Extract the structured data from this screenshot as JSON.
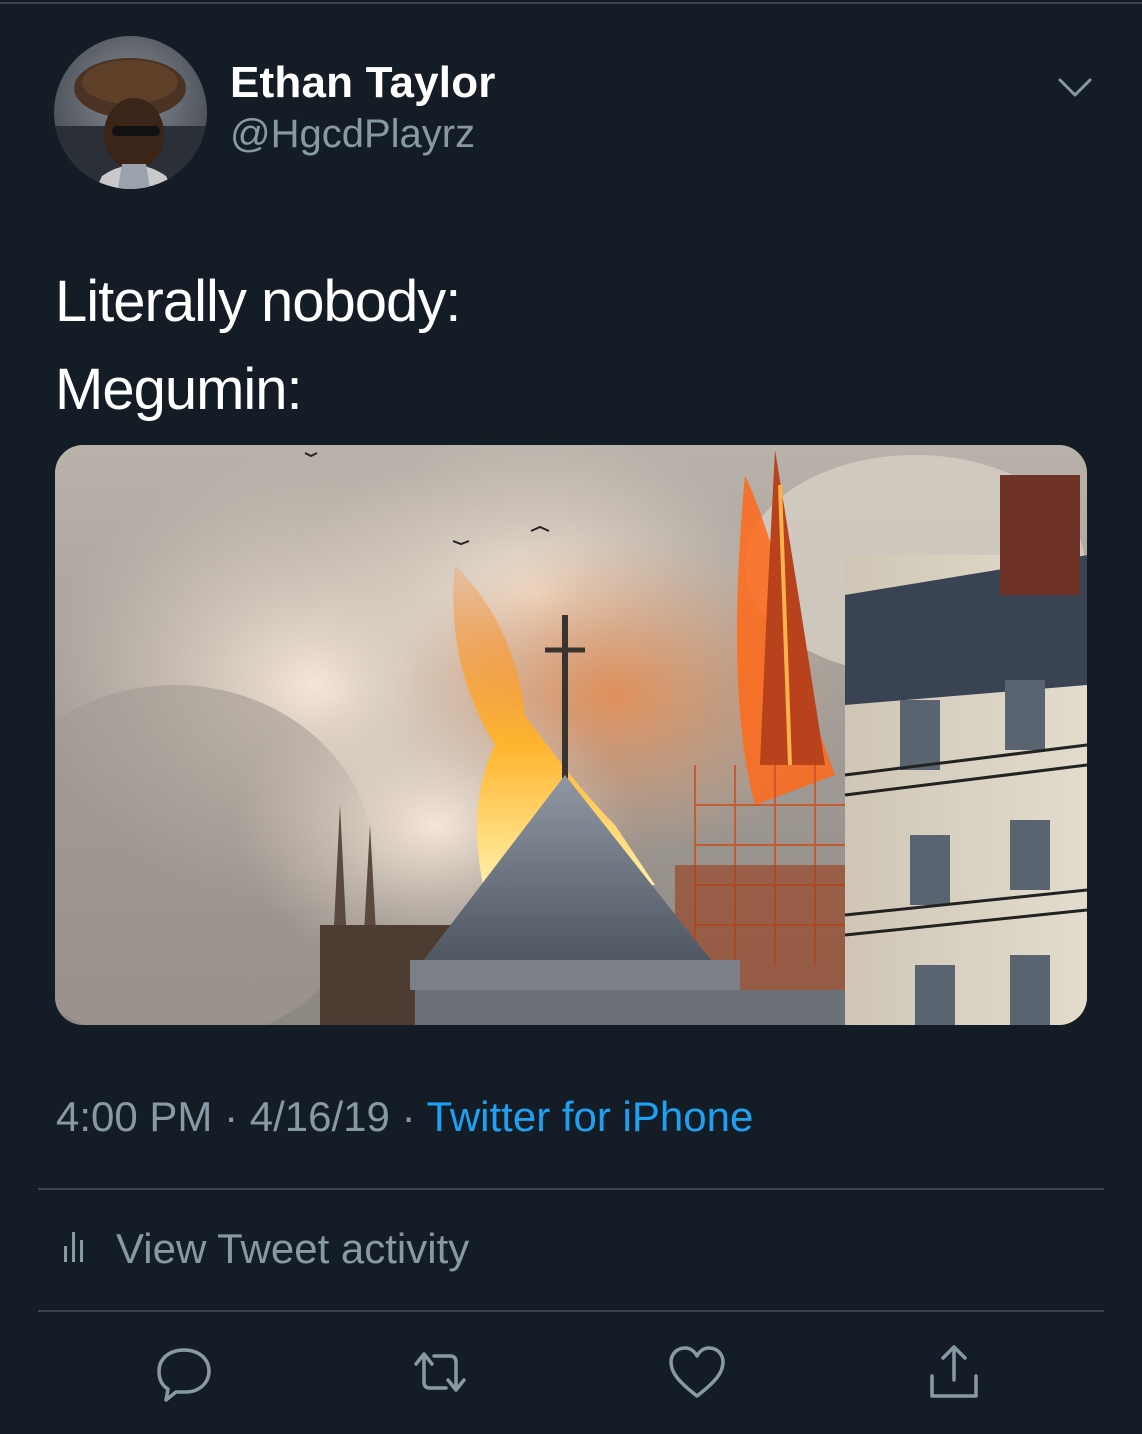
{
  "tweet": {
    "author": {
      "display_name": "Ethan Taylor",
      "handle": "@HgcdPlayrz"
    },
    "text_lines": [
      "Literally nobody:",
      "Megumin:"
    ],
    "time": "4:00 PM",
    "date": "4/16/19",
    "source": "Twitter for iPhone",
    "separator": "·"
  },
  "activity": {
    "label": "View Tweet activity"
  },
  "icons": {
    "header_menu": "chevron-down-icon",
    "activity": "bar-chart-icon",
    "actions": [
      "reply-icon",
      "retweet-icon",
      "like-icon",
      "share-icon"
    ]
  },
  "colors": {
    "background": "#141d26",
    "text_primary": "#ffffff",
    "text_secondary": "#8899a6",
    "link": "#1da1f2",
    "divider": "#38444d"
  }
}
